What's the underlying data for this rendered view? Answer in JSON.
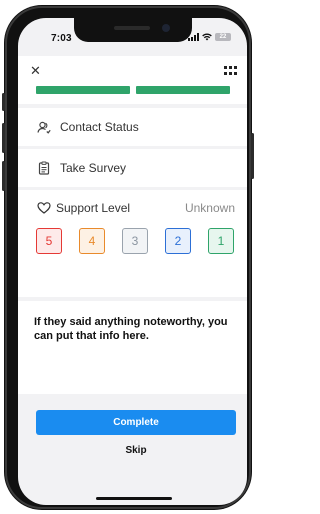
{
  "status_bar": {
    "time": "7:03",
    "battery": "22"
  },
  "header": {
    "close_glyph": "✕",
    "menu_icon": "grid-menu-icon"
  },
  "progress": {
    "segments_filled": 2,
    "segments_total": 2,
    "color": "#2fa46a"
  },
  "rows": [
    {
      "label": "Contact Status",
      "icon": "contact-status-icon"
    },
    {
      "label": "Take Survey",
      "icon": "clipboard-icon"
    }
  ],
  "support": {
    "label": "Support Level",
    "value": "Unknown",
    "icon": "heart-icon",
    "options": [
      {
        "label": "5",
        "color": "#e53935",
        "bg": "#fdeaea"
      },
      {
        "label": "4",
        "color": "#e98a2b",
        "bg": "#fdf1e4"
      },
      {
        "label": "3",
        "color": "#8a94a0",
        "bg": "#f2f4f6"
      },
      {
        "label": "2",
        "color": "#2c6fd6",
        "bg": "#e8f0fc"
      },
      {
        "label": "1",
        "color": "#2fa46a",
        "bg": "#e7f6ee"
      }
    ]
  },
  "notes": {
    "text": "If they said anything noteworthy, you can put that info here."
  },
  "actions": {
    "complete_label": "Complete",
    "skip_label": "Skip"
  },
  "colors": {
    "accent": "#1a8cf0",
    "background": "#f2f2f4"
  }
}
